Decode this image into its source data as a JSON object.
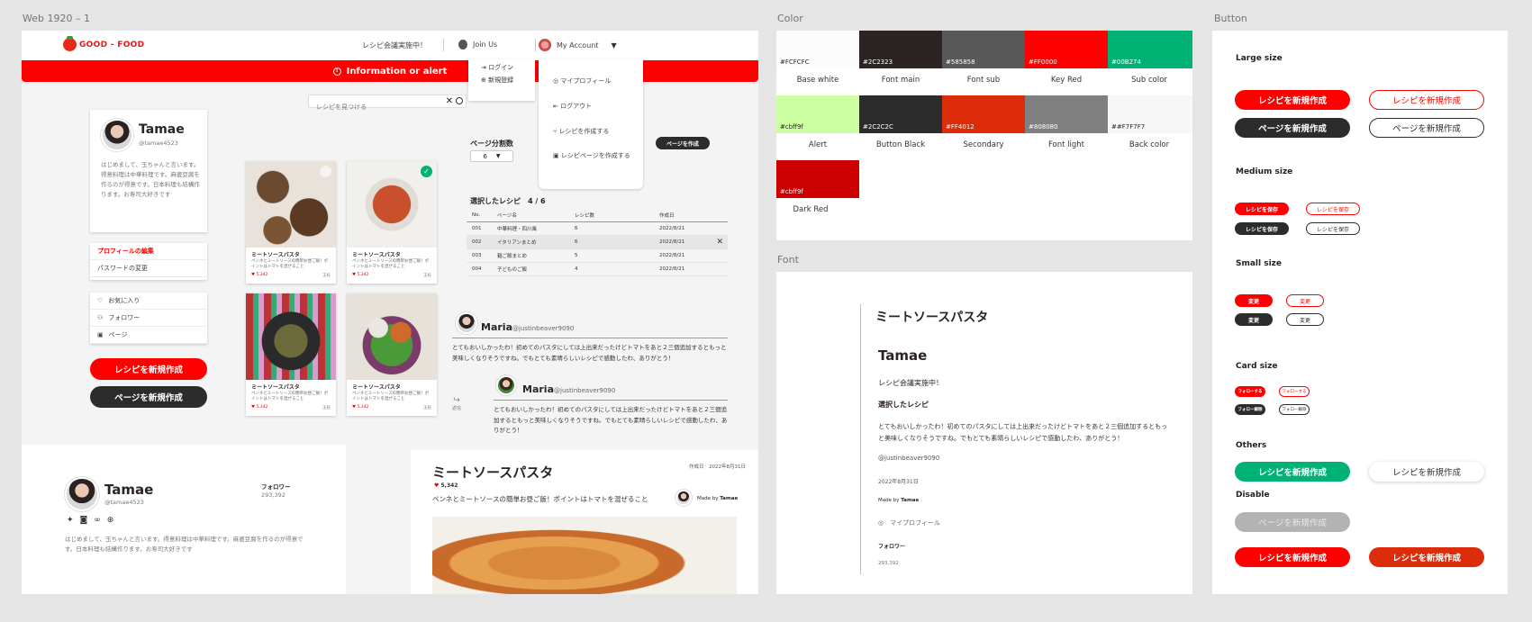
{
  "frames": {
    "web": "Web 1920 – 1",
    "color": "Color",
    "font": "Font",
    "button": "Button"
  },
  "header": {
    "logo": "GOOD - FOOD",
    "announcement": "レシピ会議実施中！",
    "join": "Join Us",
    "account": "My Account"
  },
  "alert": {
    "label": "Information or alert"
  },
  "search": {
    "placeholder": "レシピを見つける"
  },
  "guest_menu": {
    "login": "ログイン",
    "signup": "新規登録"
  },
  "account_menu": {
    "items": [
      "マイプロフィール",
      "ログアウト",
      "レシピを作成する",
      "レシピページを作成する"
    ]
  },
  "profile": {
    "name": "Tamae",
    "handle": "@tamae4523",
    "bio": "はじめまして、玉ちゃんと言います。得意料理は中華料理です。麻婆豆腐を作るのが得意です。日本料理も結構作ります。お寿司大好きです",
    "edit": "プロフィールの編集",
    "password": "パスワードの変更"
  },
  "nav": {
    "items": [
      "お気に入り",
      "フォロワー",
      "ページ"
    ]
  },
  "actions": {
    "create_recipe": "レシピを新規作成",
    "create_page": "ページを新規作成"
  },
  "recipes": [
    {
      "title": "ミートソースパスタ",
      "desc": "ペンネとミートソースの簡単お昼ご飯！ポイントはトマトを混ぜること",
      "likes": "5,342",
      "user": "玉枝"
    },
    {
      "title": "ミートソースパスタ",
      "desc": "ペンネとミートソースの簡単お昼ご飯！ポイントはトマトを混ぜること",
      "likes": "5,342",
      "user": "玉枝"
    },
    {
      "title": "ミートソースパスタ",
      "desc": "ペンネとミートソースの簡単お昼ご飯！ポイントはトマトを混ぜること",
      "likes": "5,342",
      "user": "玉枝"
    },
    {
      "title": "ミートソースパスタ",
      "desc": "ペンネとミートソースの簡単お昼ご飯！ポイントはトマトを混ぜること",
      "likes": "5,342",
      "user": "玉枝"
    }
  ],
  "paging": {
    "label": "ページ分割数",
    "value": "6",
    "create_btn": "ページを作成"
  },
  "selected": {
    "label": "選択したレシピ",
    "count": "4 / 6"
  },
  "table": {
    "headers": [
      "No.",
      "ページ名",
      "レシピ数",
      "作成日"
    ],
    "rows": [
      [
        "001",
        "中華料理・四川風",
        "6",
        "2022/8/21"
      ],
      [
        "002",
        "イタリアンまとめ",
        "6",
        "2022/8/21"
      ],
      [
        "003",
        "麺ご飯まとめ",
        "5",
        "2022/8/21"
      ],
      [
        "004",
        "子どものご飯",
        "4",
        "2022/8/21"
      ]
    ]
  },
  "comments": [
    {
      "name": "Maria",
      "handle": "@justinbeaver9090",
      "text": "とてもおいしかったわ！初めてのパスタにしては上出来だったけどトマトをあと２三個追加するともっと美味しくなりそうですね。でもとても素晴らしいレシピで感動したわ、ありがとう！"
    },
    {
      "name": "Maria",
      "handle": "@justinbeaver9090",
      "text": "とてもおいしかったわ！初めてのパスタにしては上出来だったけどトマトをあと２三個追加するともっと美味しくなりそうですね。でもとても素晴らしいレシピで感動したわ、ありがとう！"
    }
  ],
  "reply": "返信",
  "profile2": {
    "name": "Tamae",
    "handle": "@tamae4523",
    "followers_label": "フォロワー",
    "followers": "293,392",
    "bio": "はじめまして、玉ちゃんと言います。得意料理は中華料理です。麻婆豆腐を作るのが得意です。日本料理も結構作ります。お寿司大好きです"
  },
  "detail": {
    "title": "ミートソースパスタ",
    "date_label": "作成日",
    "date": "2022年8月31日",
    "likes": "5,342",
    "desc": "ペンネとミートソースの簡単お昼ご飯！ポイントはトマトを混ぜること",
    "made_by": "Made by",
    "author": "Tamae"
  },
  "palette": [
    {
      "hex": "#FCFCFC",
      "name": "Base white",
      "color": "#FCFCFC",
      "text": "#2c2323"
    },
    {
      "hex": "#2C2323",
      "name": "Font main",
      "color": "#2C2323",
      "text": "#ffffff"
    },
    {
      "hex": "#585858",
      "name": "Font sub",
      "color": "#585858",
      "text": "#ffffff"
    },
    {
      "hex": "#FF0000",
      "name": "Key Red",
      "color": "#FF0000",
      "text": "#ffffff"
    },
    {
      "hex": "#00B274",
      "name": "Sub color",
      "color": "#00B274",
      "text": "#ffffff"
    },
    {
      "hex": "#cbff9f",
      "name": "Alert",
      "color": "#CBFF9F",
      "text": "#2c2323"
    },
    {
      "hex": "#2C2C2C",
      "name": "Button Black",
      "color": "#2C2C2C",
      "text": "#ffffff"
    },
    {
      "hex": "#FF4012",
      "name": "Secondary",
      "color": "#DD2C0A",
      "text": "#ffffff"
    },
    {
      "hex": "#808080",
      "name": "Font light",
      "color": "#808080",
      "text": "#ffffff"
    },
    {
      "hex": "##F7F7F7",
      "name": "Back color",
      "color": "#F7F7F7",
      "text": "#2c2323"
    },
    {
      "hex": "#cbff9f",
      "name": "Dark Red",
      "color": "#CC0000",
      "text": "#ffffff"
    }
  ],
  "font_sample": {
    "h1": "ミートソースパスタ",
    "h2": "Tamae",
    "p1": "レシピ会議実施中！",
    "h3": "選択したレシピ",
    "body": "とてもおいしかったわ！初めてのパスタにしては上出来だったけどトマトをあと２三個追加するともっと美味しくなりそうですね。でもとても素晴らしいレシピで感動したわ、ありがとう！",
    "handle": "@justinbeaver9090",
    "date": "2022年8月31日",
    "made_by": "Made by",
    "author": "Tamae",
    "profile_link": "マイプロフィール",
    "followers_label": "フォロワー",
    "followers": "293,392"
  },
  "buttons": {
    "large": "Large size",
    "medium": "Medium size",
    "small": "Small size",
    "card": "Card size",
    "others": "Others",
    "disable": "Disable",
    "create_recipe": "レシピを新規作成",
    "create_page": "ページを新規作成",
    "save": "レシピを保存",
    "change": "変更",
    "follow": "フォローする",
    "unfollow": "フォロー解除"
  }
}
